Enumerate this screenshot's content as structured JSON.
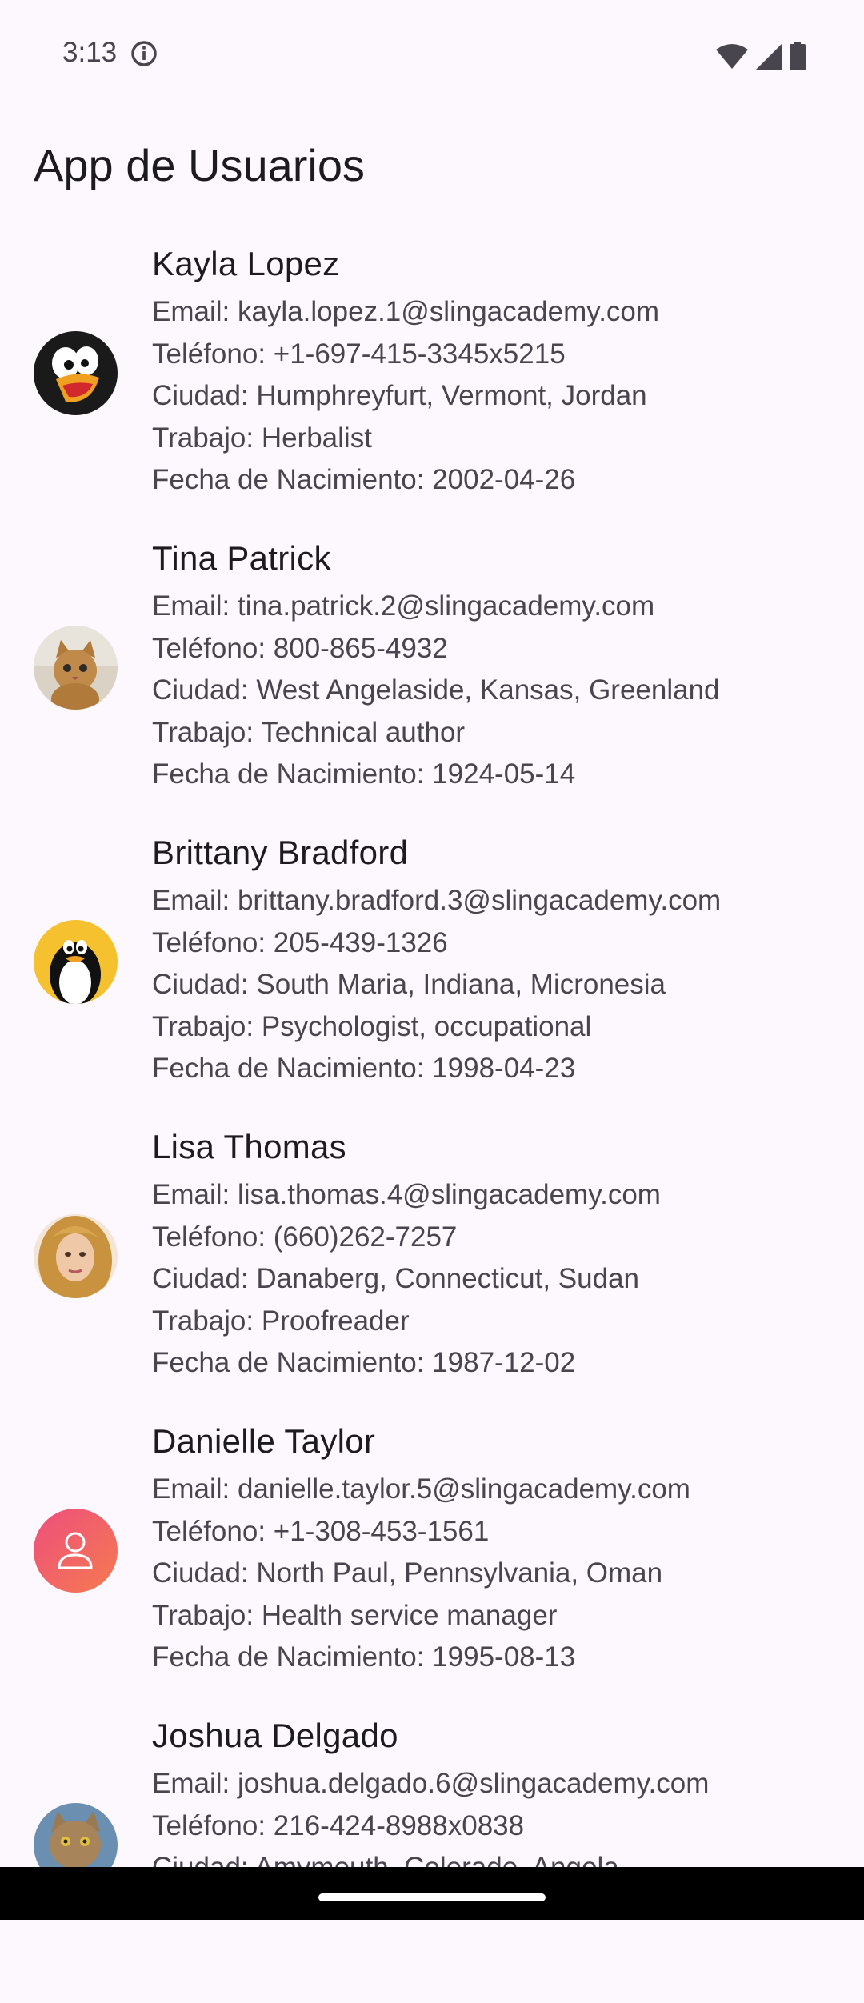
{
  "status_bar": {
    "time": "3:13"
  },
  "app_bar": {
    "title": "App de Usuarios"
  },
  "users": [
    {
      "name": "Kayla Lopez",
      "email": "Email: kayla.lopez.1@slingacademy.com",
      "phone": "Teléfono: +1-697-415-3345x5215",
      "city": "Ciudad: Humphreyfurt, Vermont, Jordan",
      "job": "Trabajo: Herbalist",
      "birth": "Fecha de Nacimiento: 2002-04-26"
    },
    {
      "name": "Tina Patrick",
      "email": "Email: tina.patrick.2@slingacademy.com",
      "phone": "Teléfono: 800-865-4932",
      "city": "Ciudad: West Angelaside, Kansas, Greenland",
      "job": "Trabajo: Technical author",
      "birth": "Fecha de Nacimiento: 1924-05-14"
    },
    {
      "name": "Brittany Bradford",
      "email": "Email: brittany.bradford.3@slingacademy.com",
      "phone": "Teléfono: 205-439-1326",
      "city": "Ciudad: South Maria, Indiana, Micronesia",
      "job": "Trabajo: Psychologist, occupational",
      "birth": "Fecha de Nacimiento: 1998-04-23"
    },
    {
      "name": "Lisa Thomas",
      "email": "Email: lisa.thomas.4@slingacademy.com",
      "phone": "Teléfono: (660)262-7257",
      "city": "Ciudad: Danaberg, Connecticut, Sudan",
      "job": "Trabajo: Proofreader",
      "birth": "Fecha de Nacimiento: 1987-12-02"
    },
    {
      "name": "Danielle Taylor",
      "email": "Email: danielle.taylor.5@slingacademy.com",
      "phone": "Teléfono: +1-308-453-1561",
      "city": "Ciudad: North Paul, Pennsylvania, Oman",
      "job": "Trabajo: Health service manager",
      "birth": "Fecha de Nacimiento: 1995-08-13"
    },
    {
      "name": "Joshua Delgado",
      "email": "Email: joshua.delgado.6@slingacademy.com",
      "phone": "Teléfono: 216-424-8988x0838",
      "city": "Ciudad: Amymouth, Colorado, Angola",
      "job": "",
      "birth": ""
    }
  ]
}
